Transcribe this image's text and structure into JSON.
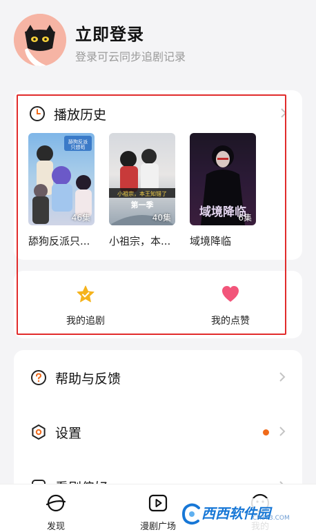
{
  "header": {
    "title": "立即登录",
    "subtitle": "登录可云同步追剧记录"
  },
  "history": {
    "title": "播放历史",
    "items": [
      {
        "cover_text": "舔狗反派只想苟",
        "episodes": "46集",
        "title": "舔狗反派只..."
      },
      {
        "cover_text": "小祖宗，本王知错了 第一季",
        "episodes": "40集",
        "title": "小祖宗，本..."
      },
      {
        "cover_text": "域境降临",
        "episodes": "6集",
        "title": "域境降临"
      }
    ]
  },
  "favorites": {
    "follow_label": "我的追剧",
    "likes_label": "我的点赞"
  },
  "settings": {
    "items": [
      {
        "label": "帮助与反馈"
      },
      {
        "label": "设置"
      },
      {
        "label": "看剧偏好"
      }
    ]
  },
  "nav": {
    "items": [
      {
        "label": "发现"
      },
      {
        "label": "漫剧广场"
      },
      {
        "label": "我的"
      }
    ]
  },
  "watermark": {
    "main": "西西软件园",
    "sub": "CR173.COM"
  },
  "colors": {
    "accent": "#f06a1a",
    "highlight_outline": "#e12a2a",
    "star": "#f5b31c",
    "heart": "#f2557a"
  }
}
